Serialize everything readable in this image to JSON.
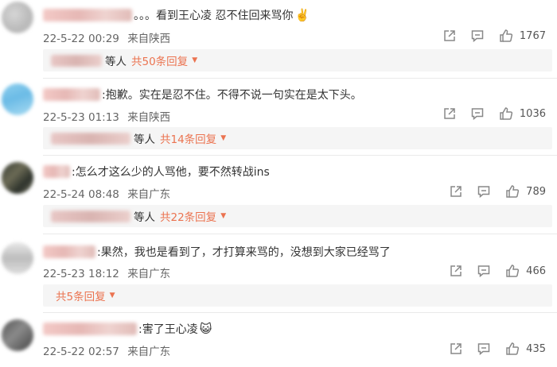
{
  "comments": [
    {
      "text": "。。。看到王心凌 忍不住回来骂你",
      "emoji": "✌️",
      "date": "22-5-22 00:29",
      "location": "来自陕西",
      "likes": "1767",
      "replies": {
        "others": "等人",
        "count": "共50条回复"
      }
    },
    {
      "text": ":抱歉。实在是忍不住。不得不说一句实在是太下头。",
      "emoji": "",
      "date": "22-5-23 01:13",
      "location": "来自陕西",
      "likes": "1036",
      "replies": {
        "others": "等人",
        "count": "共14条回复"
      }
    },
    {
      "text": ":怎么才这么少的人骂他，要不然转战ins",
      "emoji": "",
      "date": "22-5-24 08:48",
      "location": "来自广东",
      "likes": "789",
      "replies": {
        "others": "等人",
        "count": "共22条回复"
      }
    },
    {
      "text": ":果然，我也是看到了，才打算来骂的，没想到大家已经骂了",
      "emoji": "",
      "date": "22-5-23 18:12",
      "location": "来自广东",
      "likes": "466",
      "replies": {
        "others": "",
        "count": "共5条回复"
      }
    },
    {
      "text": ":害了王心凌",
      "emoji": "😺",
      "date": "22-5-22 02:57",
      "location": "来自广东",
      "likes": "435"
    }
  ],
  "icons": {
    "share": "share-icon",
    "comment": "comment-icon",
    "like": "thumbs-up-icon",
    "caret": "caret-down-icon"
  },
  "colors": {
    "reply_link": "#eb7350",
    "meta": "#666666",
    "reply_bg": "#f5f5f5"
  }
}
